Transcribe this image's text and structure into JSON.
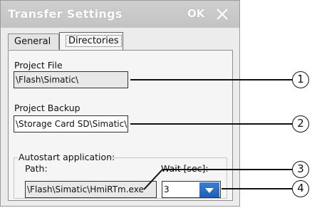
{
  "window": {
    "title": "Transfer Settings",
    "ok_label": "OK"
  },
  "icons": {
    "close": "close-icon",
    "dropdown": "chevron-down-icon"
  },
  "tabs": [
    {
      "label": "General",
      "active": false
    },
    {
      "label": "Directories",
      "active": true
    }
  ],
  "project_file": {
    "label": "Project File",
    "value": "\\Flash\\Simatic\\"
  },
  "project_backup": {
    "label": "Project Backup",
    "value": "\\Storage Card SD\\Simatic\\"
  },
  "autostart": {
    "group_label": "Autostart application:",
    "path_label": "Path:",
    "path_value": "\\Flash\\Simatic\\HmiRTm.exe",
    "wait_label": "Wait [sec]:",
    "wait_value": "3"
  },
  "callouts": [
    "1",
    "2",
    "3",
    "4"
  ],
  "colors": {
    "accent": "#1e5eb5",
    "titlebar": "#c9c9c9"
  }
}
